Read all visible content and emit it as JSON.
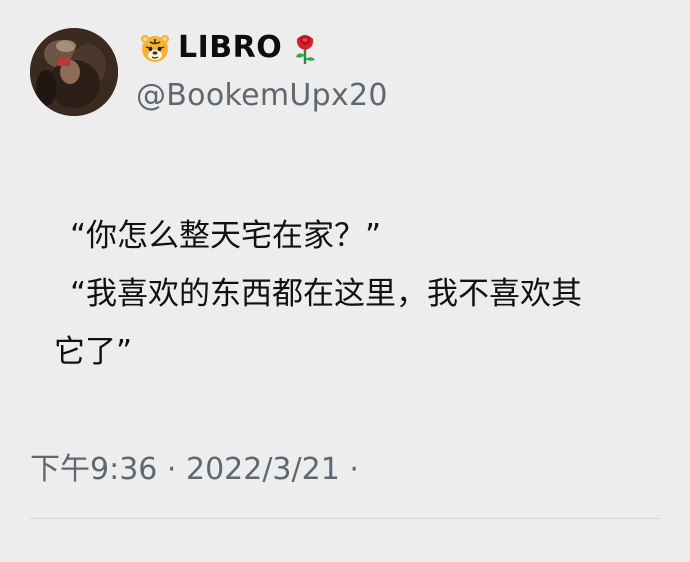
{
  "tweet": {
    "author": {
      "display_name": "LIBRO",
      "handle": "@BookemUpx20",
      "prefix_emoji_icon": "tiger-face-icon",
      "suffix_emoji_icon": "rose-icon"
    },
    "text_lines": [
      "“你怎么整天宅在家？”",
      "“我喜欢的东西都在这里，我不喜欢其",
      "它了”"
    ],
    "timestamp": "下午9:36 · 2022/3/21 ·"
  },
  "colors": {
    "background": "#ededed",
    "text": "#111111",
    "secondary_text": "#5f6870",
    "divider": "#d5d5d5"
  }
}
